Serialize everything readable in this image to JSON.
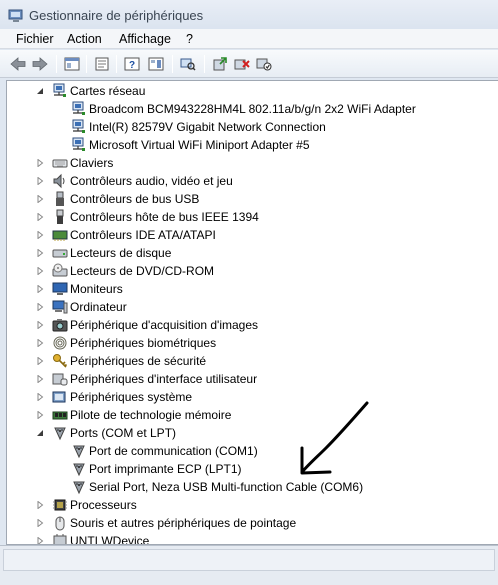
{
  "window": {
    "title": "Gestionnaire de périphériques"
  },
  "menu": {
    "items": [
      {
        "label": "Fichier"
      },
      {
        "label": "Action"
      },
      {
        "label": "Affichage"
      },
      {
        "label": "?"
      }
    ]
  },
  "toolbar": {
    "buttons": [
      {
        "icon": "back-arrow-icon"
      },
      {
        "icon": "forward-arrow-icon"
      },
      {
        "icon": "show-hide-tree-icon"
      },
      {
        "icon": "properties-icon"
      },
      {
        "icon": "help-icon"
      },
      {
        "icon": "action-pane-icon"
      },
      {
        "icon": "scan-hardware-icon"
      },
      {
        "icon": "update-driver-icon"
      },
      {
        "icon": "uninstall-icon"
      },
      {
        "icon": "disable-device-icon"
      }
    ]
  },
  "tree": {
    "rows": [
      {
        "label": "Cartes réseau",
        "level": 0,
        "expanded": true,
        "icon": "network-adapter-icon"
      },
      {
        "label": "Broadcom BCM943228HM4L 802.11a/b/g/n 2x2 WiFi Adapter",
        "level": 1,
        "icon": "network-adapter-icon"
      },
      {
        "label": "Intel(R) 82579V Gigabit Network Connection",
        "level": 1,
        "icon": "network-adapter-icon"
      },
      {
        "label": "Microsoft Virtual WiFi Miniport Adapter #5",
        "level": 1,
        "icon": "network-adapter-icon"
      },
      {
        "label": "Claviers",
        "level": 0,
        "expanded": false,
        "icon": "keyboard-icon"
      },
      {
        "label": "Contrôleurs audio, vidéo et jeu",
        "level": 0,
        "expanded": false,
        "icon": "speaker-icon"
      },
      {
        "label": "Contrôleurs de bus USB",
        "level": 0,
        "expanded": false,
        "icon": "usb-icon"
      },
      {
        "label": "Contrôleurs hôte de bus IEEE 1394",
        "level": 0,
        "expanded": false,
        "icon": "firewire-icon"
      },
      {
        "label": "Contrôleurs IDE ATA/ATAPI",
        "level": 0,
        "expanded": false,
        "icon": "ide-controller-icon"
      },
      {
        "label": "Lecteurs de disque",
        "level": 0,
        "expanded": false,
        "icon": "disk-drive-icon"
      },
      {
        "label": "Lecteurs de DVD/CD-ROM",
        "level": 0,
        "expanded": false,
        "icon": "dvd-drive-icon"
      },
      {
        "label": "Moniteurs",
        "level": 0,
        "expanded": false,
        "icon": "monitor-icon"
      },
      {
        "label": "Ordinateur",
        "level": 0,
        "expanded": false,
        "icon": "computer-icon"
      },
      {
        "label": "Périphérique d'acquisition d'images",
        "level": 0,
        "expanded": false,
        "icon": "camera-icon"
      },
      {
        "label": "Périphériques biométriques",
        "level": 0,
        "expanded": false,
        "icon": "fingerprint-icon"
      },
      {
        "label": "Périphériques de sécurité",
        "level": 0,
        "expanded": false,
        "icon": "key-icon"
      },
      {
        "label": "Périphériques d'interface utilisateur",
        "level": 0,
        "expanded": false,
        "icon": "hid-icon"
      },
      {
        "label": "Périphériques système",
        "level": 0,
        "expanded": false,
        "icon": "system-device-icon"
      },
      {
        "label": "Pilote de technologie mémoire",
        "level": 0,
        "expanded": false,
        "icon": "memory-icon"
      },
      {
        "label": "Ports (COM et LPT)",
        "level": 0,
        "expanded": true,
        "icon": "port-icon"
      },
      {
        "label": "Port de communication (COM1)",
        "level": 1,
        "icon": "port-icon"
      },
      {
        "label": "Port imprimante ECP (LPT1)",
        "level": 1,
        "icon": "port-icon"
      },
      {
        "label": "Serial Port, Neza USB Multi-function Cable  (COM6)",
        "level": 1,
        "icon": "port-icon"
      },
      {
        "label": "Processeurs",
        "level": 0,
        "expanded": false,
        "icon": "processor-icon"
      },
      {
        "label": "Souris et autres périphériques de pointage",
        "level": 0,
        "expanded": false,
        "icon": "mouse-icon"
      },
      {
        "label": "UNTI WDevice",
        "level": 0,
        "expanded": false,
        "icon": "device-icon"
      }
    ]
  }
}
